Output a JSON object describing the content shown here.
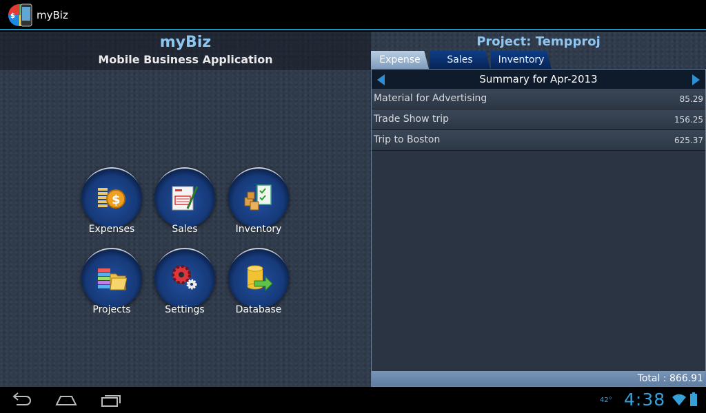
{
  "app": {
    "title": "myBiz"
  },
  "left": {
    "brand": "myBiz",
    "subtitle": "Mobile Business Application",
    "tiles": [
      {
        "label": "Expenses",
        "icon": "expenses-icon"
      },
      {
        "label": "Sales",
        "icon": "sales-icon"
      },
      {
        "label": "Inventory",
        "icon": "inventory-icon"
      },
      {
        "label": "Projects",
        "icon": "projects-icon"
      },
      {
        "label": "Settings",
        "icon": "settings-icon"
      },
      {
        "label": "Database",
        "icon": "database-icon"
      }
    ]
  },
  "right": {
    "project_title": "Project: Tempproj",
    "tabs": [
      {
        "label": "Expense",
        "active": true
      },
      {
        "label": "Sales",
        "active": false
      },
      {
        "label": "Inventory",
        "active": false
      }
    ],
    "summary": "Summary for Apr-2013",
    "rows": [
      {
        "desc": "Material for Advertising",
        "amount": "85.29"
      },
      {
        "desc": "Trade Show trip",
        "amount": "156.25"
      },
      {
        "desc": "Trip to Boston",
        "amount": "625.37"
      }
    ],
    "total": "Total : 866.91"
  },
  "status": {
    "temperature": "42°",
    "time": "4:38"
  },
  "colors": {
    "accent": "#8fc6f0",
    "clock": "#36a0d8",
    "tab_active": "#9bb4cf",
    "tab_inactive": "#0b3373"
  }
}
